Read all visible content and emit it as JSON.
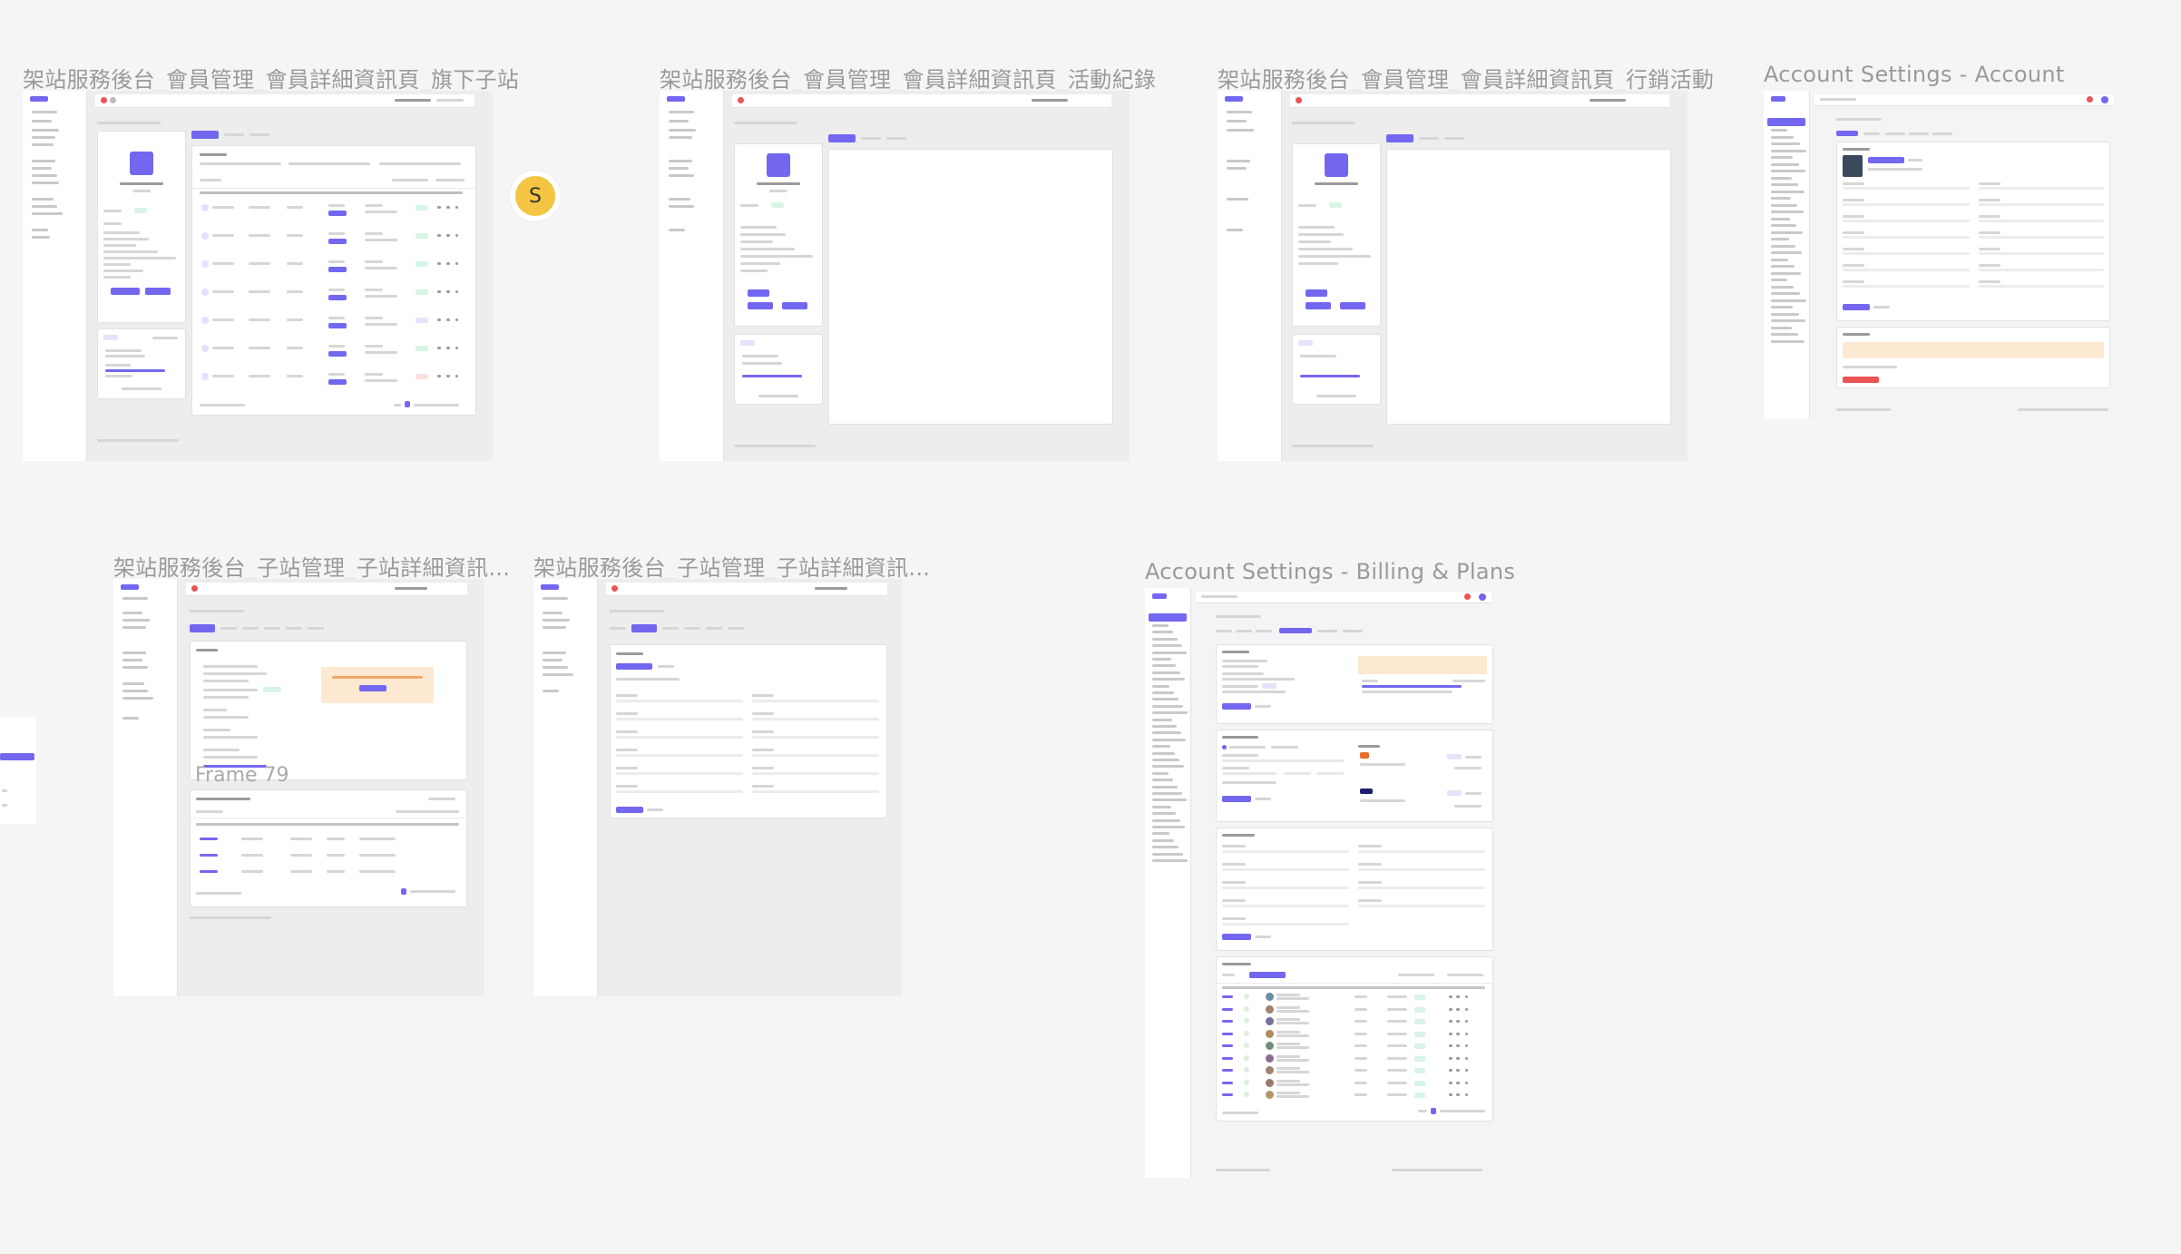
{
  "frames": {
    "f1": {
      "title": "架站服務後台_會員管理_會員詳細資訊頁_旗下子站"
    },
    "f2": {
      "title": "架站服務後台_會員管理_會員詳細資訊頁_活動紀錄"
    },
    "f3": {
      "title": "架站服務後台_會員管理_會員詳細資訊頁_行銷活動"
    },
    "f4": {
      "title": "Account Settings - Account"
    },
    "f5": {
      "title": "架站服務後台_子站管理_子站詳細資訊..."
    },
    "f6": {
      "title": "架站服務後台_子站管理_子站詳細資訊..."
    },
    "f7": {
      "title": "Account Settings - Billing & Plans"
    }
  },
  "canvas": {
    "presence_avatar_letter": "S",
    "frame79_label": "Frame 79"
  },
  "colors": {
    "primary": "#7367f0",
    "success": "#28c76f",
    "warning": "#ff9f43",
    "canvas_bg": "#f5f5f5",
    "title_gray": "#9a9a9a"
  }
}
